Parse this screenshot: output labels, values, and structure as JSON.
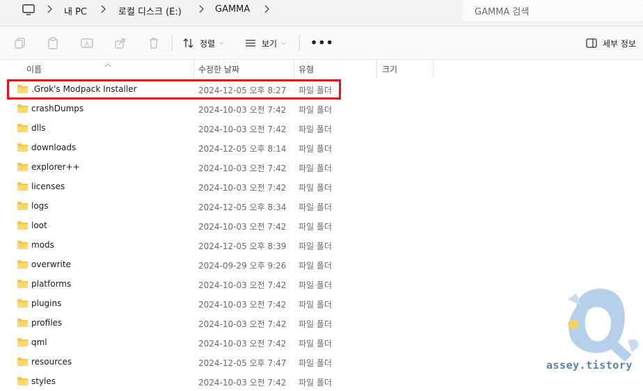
{
  "address": {
    "crumbs": [
      "내 PC",
      "로컬 디스크 (E:)",
      "GAMMA"
    ],
    "search_placeholder": "GAMMA 검색"
  },
  "toolbar": {
    "sort_label": "정렬",
    "view_label": "보기",
    "more_label": "•••",
    "details_label": "세부 정보"
  },
  "columns": {
    "name": "이름",
    "modified": "수정한 날짜",
    "type": "유형",
    "size": "크기"
  },
  "files": [
    {
      "name": ".Grok's Modpack Installer",
      "modified": "2024-12-05 오후 8:27",
      "type": "파일 폴더"
    },
    {
      "name": "crashDumps",
      "modified": "2024-10-03 오전 7:42",
      "type": "파일 폴더"
    },
    {
      "name": "dlls",
      "modified": "2024-10-03 오전 7:42",
      "type": "파일 폴더"
    },
    {
      "name": "downloads",
      "modified": "2024-12-05 오후 8:14",
      "type": "파일 폴더"
    },
    {
      "name": "explorer++",
      "modified": "2024-10-03 오전 7:42",
      "type": "파일 폴더"
    },
    {
      "name": "licenses",
      "modified": "2024-10-03 오전 7:42",
      "type": "파일 폴더"
    },
    {
      "name": "logs",
      "modified": "2024-12-05 오후 8:34",
      "type": "파일 폴더"
    },
    {
      "name": "loot",
      "modified": "2024-10-03 오전 7:42",
      "type": "파일 폴더"
    },
    {
      "name": "mods",
      "modified": "2024-12-05 오후 8:39",
      "type": "파일 폴더"
    },
    {
      "name": "overwrite",
      "modified": "2024-09-29 오후 9:26",
      "type": "파일 폴더"
    },
    {
      "name": "platforms",
      "modified": "2024-10-03 오전 7:42",
      "type": "파일 폴더"
    },
    {
      "name": "plugins",
      "modified": "2024-10-03 오전 7:42",
      "type": "파일 폴더"
    },
    {
      "name": "profiles",
      "modified": "2024-10-03 오전 7:42",
      "type": "파일 폴더"
    },
    {
      "name": "qml",
      "modified": "2024-10-03 오전 7:42",
      "type": "파일 폴더"
    },
    {
      "name": "resources",
      "modified": "2024-12-05 오후 7:47",
      "type": "파일 폴더"
    },
    {
      "name": "styles",
      "modified": "2024-10-03 오전 7:42",
      "type": "파일 폴더"
    }
  ],
  "colors": {
    "folder": "#f4c34a",
    "highlight": "#e0141e",
    "watermark": "#b7d0ea"
  },
  "watermark": {
    "text": "assey.tistory"
  }
}
